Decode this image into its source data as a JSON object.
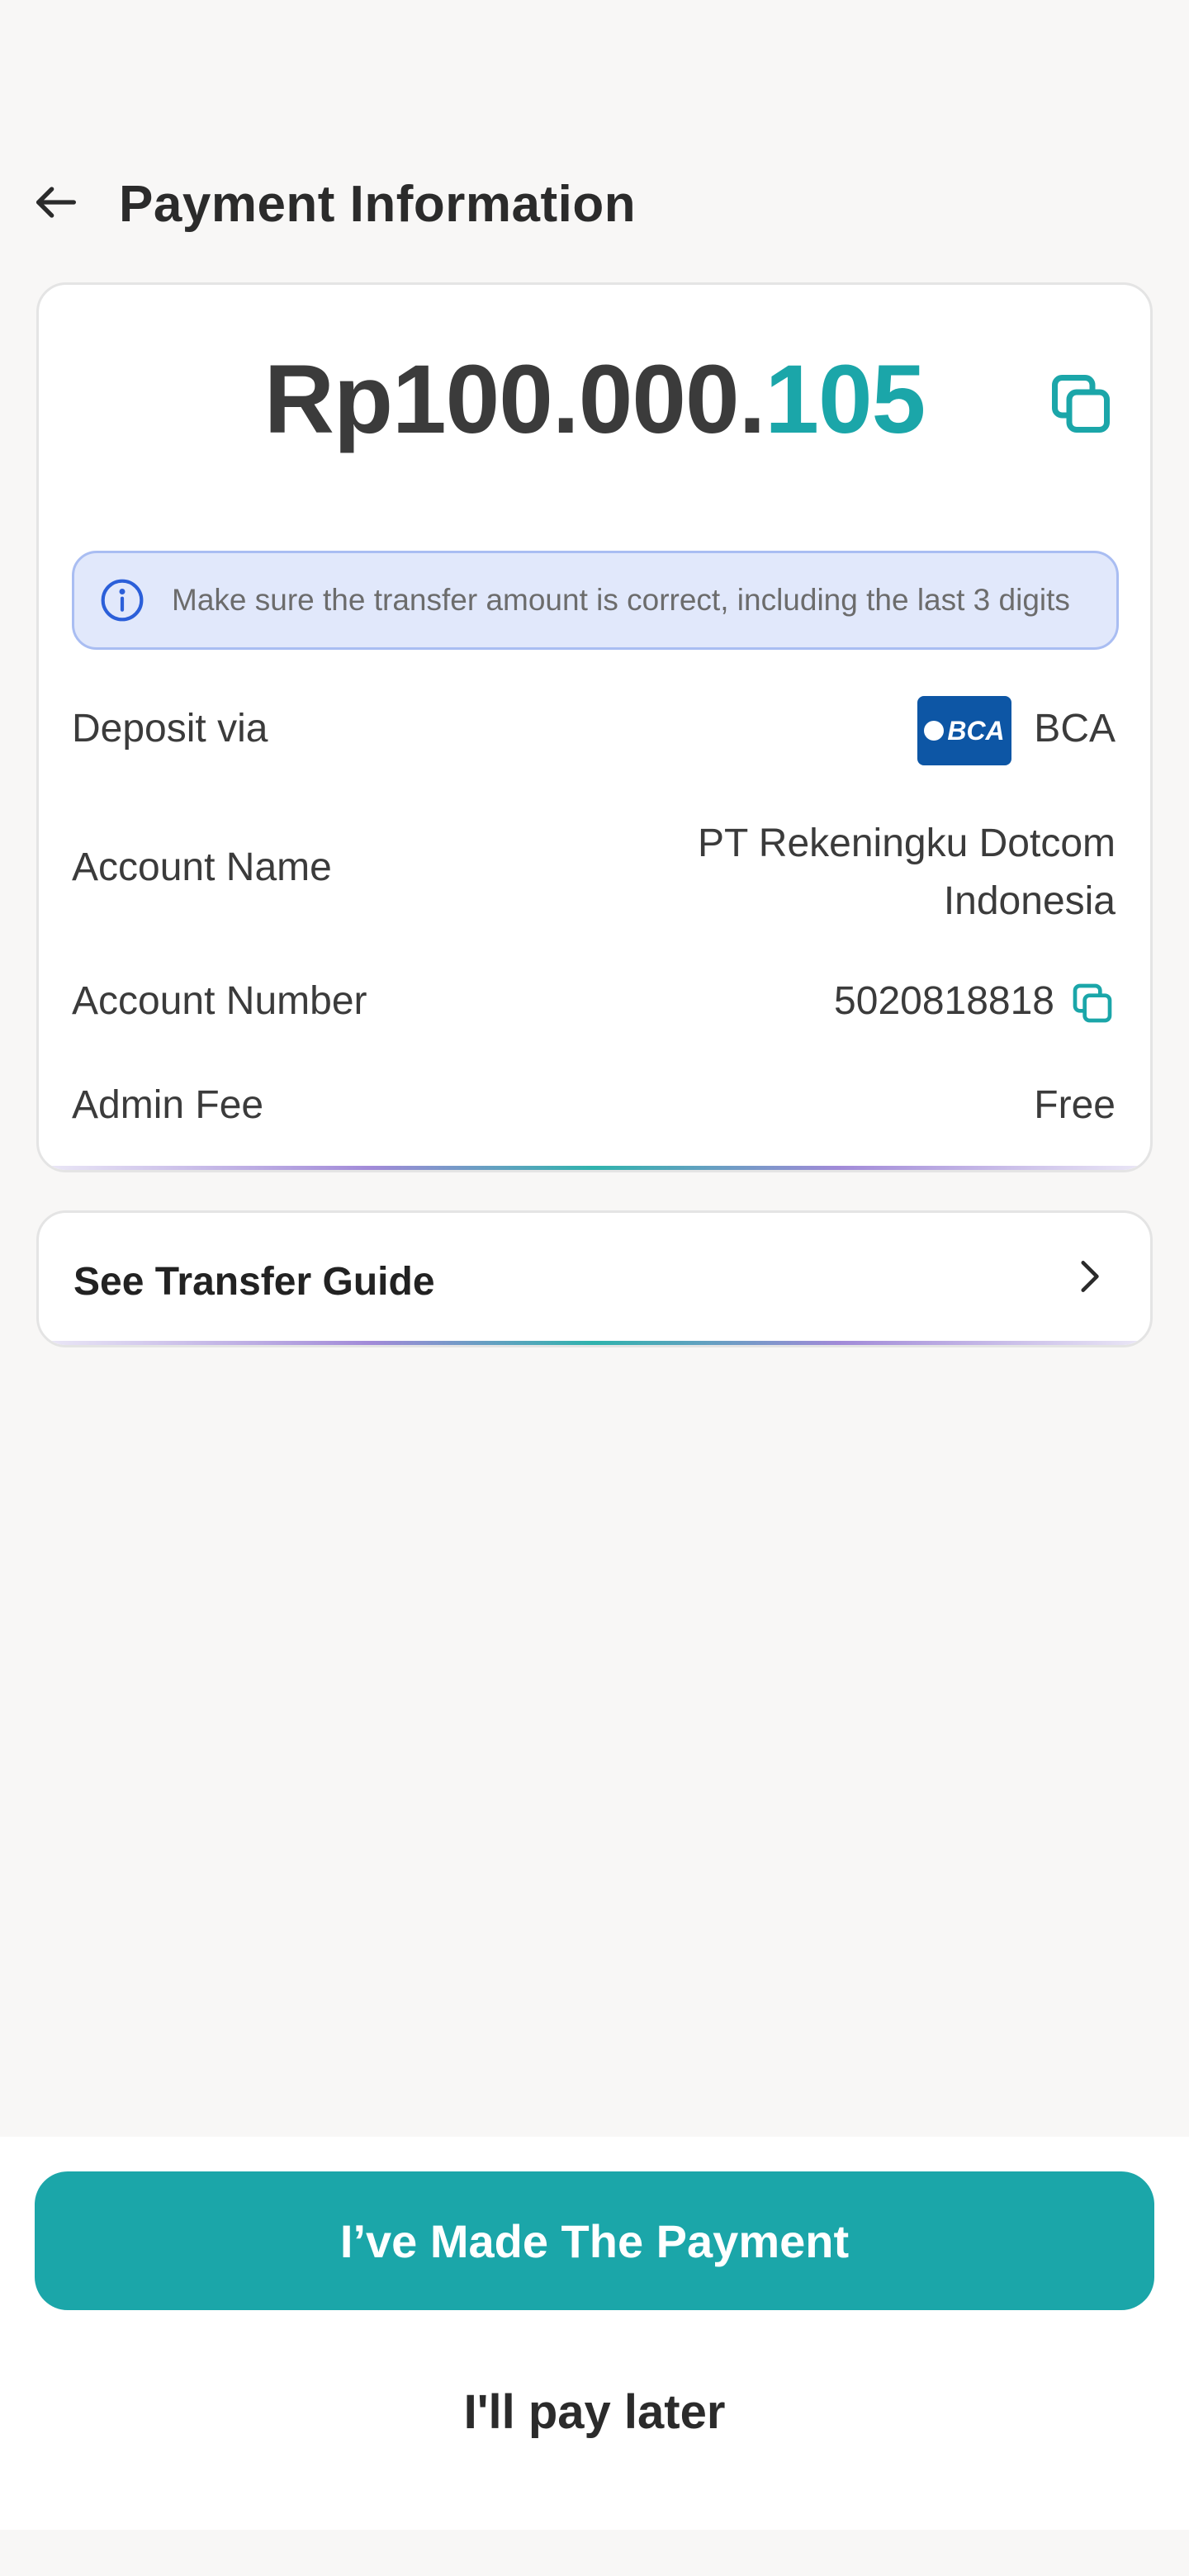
{
  "header": {
    "title": "Payment Information",
    "back_icon": "arrow-left-icon"
  },
  "amount": {
    "main": "Rp100.000.",
    "unique_digits": "105",
    "copy_icon": "copy-icon",
    "accent_color": "#1ba6a9"
  },
  "notice": {
    "icon": "info-icon",
    "text": "Make sure the transfer amount is correct, including the last 3 digits"
  },
  "details": {
    "deposit_label": "Deposit via",
    "bank_logo_text": "BCA",
    "bank_name": "BCA",
    "account_name_label": "Account Name",
    "account_name_line1": "PT Rekeningku Dotcom",
    "account_name_line2": "Indonesia",
    "account_number_label": "Account Number",
    "account_number": "5020818818",
    "admin_fee_label": "Admin Fee",
    "admin_fee": "Free"
  },
  "guide": {
    "label": "See Transfer Guide",
    "chevron_icon": "chevron-right-icon"
  },
  "actions": {
    "primary_label": "I’ve Made The Payment",
    "secondary_label": "I'll pay later"
  }
}
